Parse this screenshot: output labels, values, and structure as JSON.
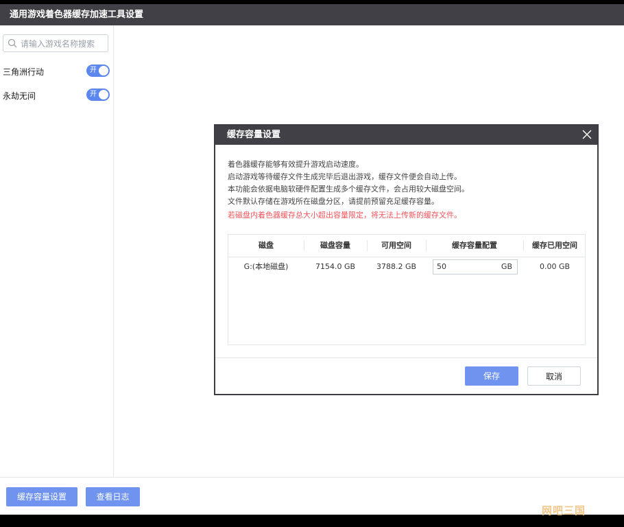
{
  "window": {
    "title": "通用游戏着色器缓存加速工具设置"
  },
  "sidebar": {
    "search_placeholder": "请输入游戏名称搜索",
    "games": [
      {
        "name": "三角洲行动",
        "toggle": "开"
      },
      {
        "name": "永劫无间",
        "toggle": "开"
      }
    ]
  },
  "footer": {
    "capacity_button": "缓存容量设置",
    "log_button": "查看日志"
  },
  "watermark": "网吧三国",
  "dialog": {
    "title": "缓存容量设置",
    "lines": [
      "着色器缓存能够有效提升游戏启动速度。",
      "启动游戏等待缓存文件生成完毕后退出游戏，缓存文件便会自动上传。",
      "本功能会依据电脑软硬件配置生成多个缓存文件，会占用较大磁盘空间。",
      "文件默认存储在游戏所在磁盘分区，请提前预留充足缓存容量。"
    ],
    "warning": "若磁盘内着色器缓存总大小超出容量限定，将无法上传新的缓存文件。",
    "table": {
      "headers": [
        "磁盘",
        "磁盘容量",
        "可用空间",
        "缓存容量配置",
        "缓存已用空间"
      ],
      "row": {
        "disk": "G:(本地磁盘)",
        "capacity": "7154.0 GB",
        "free": "3788.2 GB",
        "config_value": "50",
        "config_unit": "GB",
        "used": "0.00 GB"
      }
    },
    "save_button": "保存",
    "cancel_button": "取消"
  },
  "colors": {
    "accent": "#6f93ee",
    "titlebar": "#404046",
    "warning": "#f2545b"
  }
}
